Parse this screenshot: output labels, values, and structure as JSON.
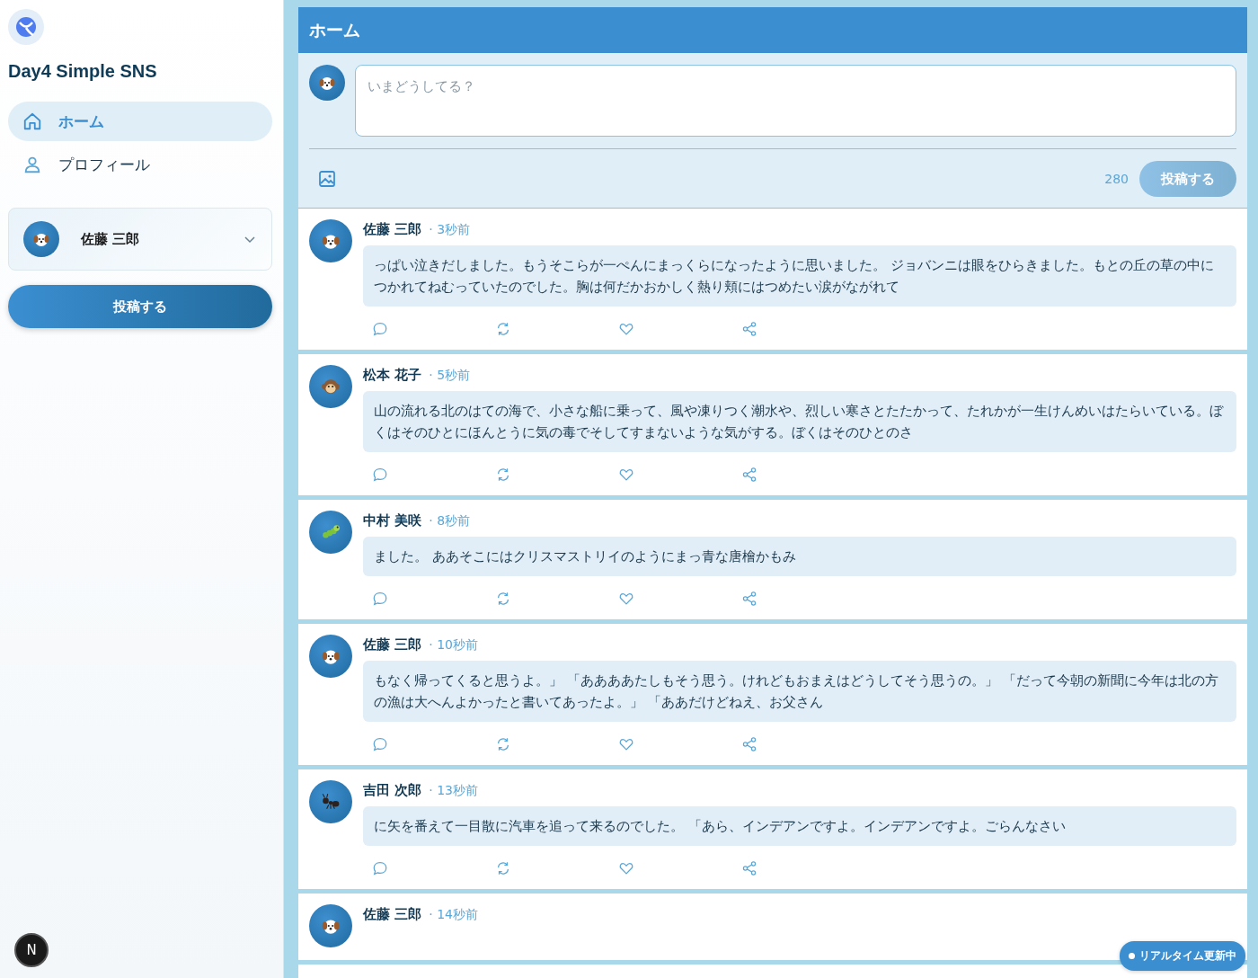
{
  "sidebar": {
    "app_title": "Day4 Simple SNS",
    "nav": [
      {
        "label": "ホーム",
        "kind": "home",
        "selected": true
      },
      {
        "label": "プロフィール",
        "kind": "user",
        "selected": false
      }
    ],
    "account": {
      "name": "佐藤 三郎",
      "avatar": {
        "kind": "dog"
      }
    },
    "post_button": "投稿する"
  },
  "header": {
    "title": "ホーム"
  },
  "composer": {
    "avatar": {
      "kind": "dog"
    },
    "placeholder": "いまどうしてる？",
    "counter": "280",
    "submit": "投稿する",
    "submit_disabled": true
  },
  "posts": [
    {
      "author": "佐藤 三郎",
      "time": "· 3秒前",
      "avatar": {
        "kind": "dog"
      },
      "body": "っぱい泣きだしました。もうそこらが一ぺんにまっくらになったように思いました。 ジョバンニは眼をひらきました。もとの丘の草の中につかれてねむっていたのでした。胸は何だかおかしく熱り頬にはつめたい涙がながれて"
    },
    {
      "author": "松本 花子",
      "time": "· 5秒前",
      "avatar": {
        "kind": "monkey"
      },
      "body": "山の流れる北のはての海で、小さな船に乗って、風や凍りつく潮水や、烈しい寒さとたたかって、たれかが一生けんめいはたらいている。ぼくはそのひとにほんとうに気の毒でそしてすまないような気がする。ぼくはそのひとのさ"
    },
    {
      "author": "中村 美咲",
      "time": "· 8秒前",
      "avatar": {
        "kind": "bug"
      },
      "body": "ました。 ああそこにはクリスマストリイのようにまっ青な唐檜かもみ"
    },
    {
      "author": "佐藤 三郎",
      "time": "· 10秒前",
      "avatar": {
        "kind": "dog"
      },
      "body": "もなく帰ってくると思うよ。」 「ああああたしもそう思う。けれどもおまえはどうしてそう思うの。」 「だって今朝の新聞に今年は北の方の漁は大へんよかったと書いてあったよ。」 「ああだけどねえ、お父さん"
    },
    {
      "author": "吉田 次郎",
      "time": "· 13秒前",
      "avatar": {
        "kind": "ant"
      },
      "body": "に矢を番えて一目散に汽車を追って来るのでした。 「あら、インデアンですよ。インデアンですよ。ごらんなさい"
    },
    {
      "author": "佐藤 三郎",
      "time": "· 14秒前",
      "avatar": {
        "kind": "dog"
      }
    }
  ],
  "realtime_badge": "リアルタイム更新中",
  "dev_badge": "N"
}
